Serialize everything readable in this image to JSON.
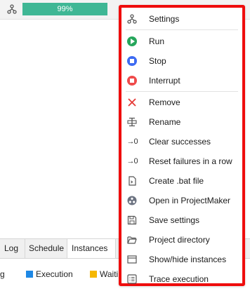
{
  "top": {
    "progress_text": "99%",
    "progress_color": "#3fb795",
    "icon": "hierarchy-icon"
  },
  "bottom": {
    "tabs": [
      {
        "label": "Log"
      },
      {
        "label": "Schedule"
      },
      {
        "label": "Instances"
      }
    ],
    "legend": [
      {
        "label": "g",
        "color": ""
      },
      {
        "label": "Execution",
        "color": "#1e88e5"
      },
      {
        "label": "Waiti",
        "color": "#f5b700"
      }
    ]
  },
  "menu": {
    "border_color": "#ef0d0d",
    "items": [
      {
        "label": "Settings",
        "icon": "hierarchy-icon"
      },
      {
        "label": "Run",
        "icon": "play-circle-icon",
        "color": "#26a65b"
      },
      {
        "label": "Stop",
        "icon": "stop-circle-icon",
        "color": "#3d6bf2"
      },
      {
        "label": "Interrupt",
        "icon": "interrupt-circle-icon",
        "color": "#ef4b4b"
      },
      {
        "label": "Remove",
        "icon": "close-icon",
        "color": "#e53935"
      },
      {
        "label": "Rename",
        "icon": "rename-icon"
      },
      {
        "label": "Clear successes",
        "icon": "arrow-zero-icon"
      },
      {
        "label": "Reset failures in a row",
        "icon": "arrow-zero-icon"
      },
      {
        "label": "Create .bat file",
        "icon": "script-file-icon"
      },
      {
        "label": "Open in ProjectMaker",
        "icon": "projectmaker-icon"
      },
      {
        "label": "Save settings",
        "icon": "save-icon"
      },
      {
        "label": "Project directory",
        "icon": "folder-open-icon"
      },
      {
        "label": "Show/hide instances",
        "icon": "window-icon"
      },
      {
        "label": "Trace execution",
        "icon": "list-icon"
      }
    ]
  }
}
